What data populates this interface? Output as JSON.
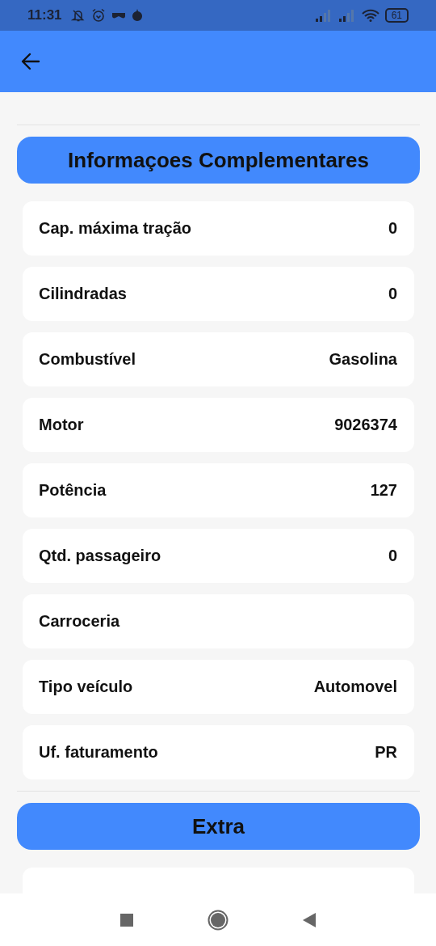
{
  "status_bar": {
    "time": "11:31",
    "battery": "61"
  },
  "sections": [
    {
      "title": "Informaçoes Complementares",
      "rows": [
        {
          "label": "Cap. máxima tração",
          "value": "0"
        },
        {
          "label": "Cilindradas",
          "value": "0"
        },
        {
          "label": "Combustível",
          "value": "Gasolina"
        },
        {
          "label": "Motor",
          "value": "9026374"
        },
        {
          "label": "Potência",
          "value": "127"
        },
        {
          "label": "Qtd. passageiro",
          "value": "0"
        },
        {
          "label": "Carroceria"
        },
        {
          "label": "Tipo veículo",
          "value": "Automovel"
        },
        {
          "label": "Uf. faturamento",
          "value": "PR"
        }
      ]
    },
    {
      "title": "Extra"
    }
  ]
}
